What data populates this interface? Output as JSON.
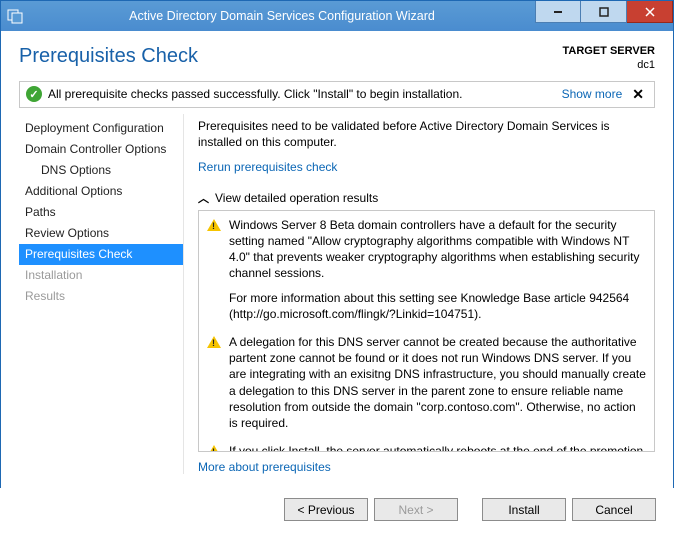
{
  "window": {
    "title": "Active Directory Domain Services Configuration Wizard"
  },
  "header": {
    "page_title": "Prerequisites Check",
    "target_label": "TARGET SERVER",
    "target_value": "dc1"
  },
  "notice": {
    "text": "All prerequisite checks passed successfully. Click \"Install\" to begin installation.",
    "show_more": "Show more"
  },
  "nav": {
    "items": [
      {
        "label": "Deployment Configuration",
        "indent": false
      },
      {
        "label": "Domain Controller Options",
        "indent": false
      },
      {
        "label": "DNS Options",
        "indent": true
      },
      {
        "label": "Additional Options",
        "indent": false
      },
      {
        "label": "Paths",
        "indent": false
      },
      {
        "label": "Review Options",
        "indent": false
      },
      {
        "label": "Prerequisites Check",
        "indent": false,
        "selected": true
      },
      {
        "label": "Installation",
        "indent": false,
        "disabled": true
      },
      {
        "label": "Results",
        "indent": false,
        "disabled": true
      }
    ]
  },
  "content": {
    "intro": "Prerequisites need to be validated before Active Directory Domain Services is installed on this computer.",
    "rerun_link": "Rerun prerequisites check",
    "expander_label": "View detailed operation results",
    "results": [
      {
        "paragraphs": [
          "Windows Server 8 Beta domain controllers have a default for the security setting named \"Allow cryptography algorithms compatible with Windows NT 4.0\" that prevents weaker cryptography algorithms when establishing security channel sessions.",
          "For more information about this setting see Knowledge Base article 942564 (http://go.microsoft.com/flingk/?Linkid=104751)."
        ]
      },
      {
        "paragraphs": [
          "A delegation for this DNS server cannot be created because the authoritative partent zone cannot be found or it does not run Windows DNS server. If you are integrating with an exisitng DNS infrastructure, you should manually create a delegation to this DNS server in the parent zone to ensure reliable name resolution from outside the domain \"corp.contoso.com\". Otherwise, no action is required."
        ]
      },
      {
        "paragraphs": [
          "If you click Install, the server automatically reboots at the end of the promotion operation."
        ]
      }
    ],
    "more_link": "More about prerequisites"
  },
  "buttons": {
    "previous": "< Previous",
    "next": "Next >",
    "install": "Install",
    "cancel": "Cancel"
  }
}
